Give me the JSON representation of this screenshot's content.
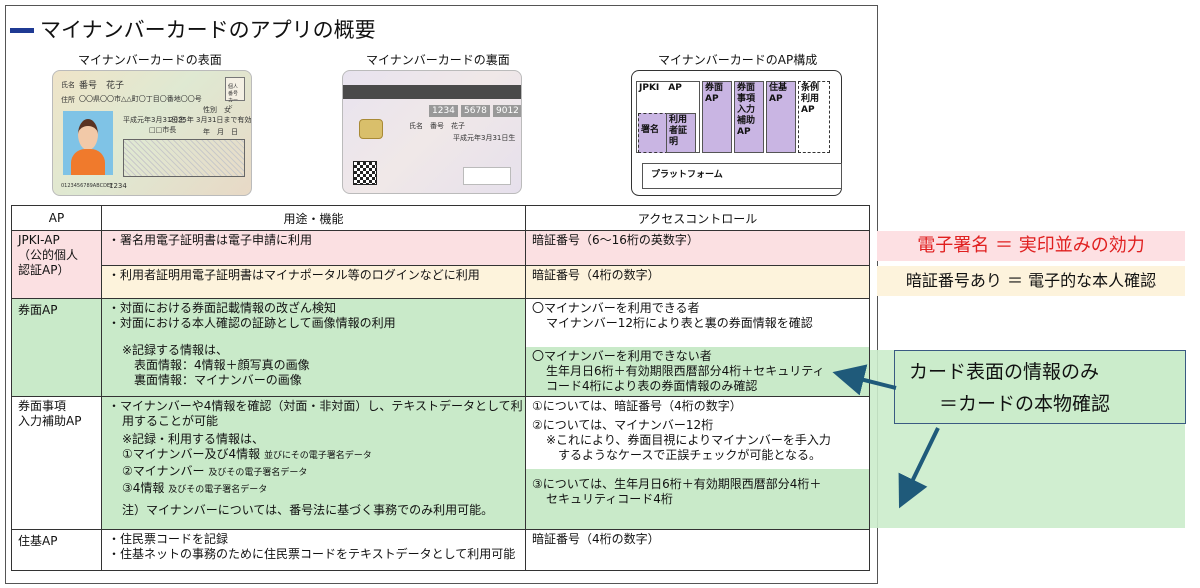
{
  "slide": {
    "title": "マイナンバーカードのアプリの概要",
    "caption_front": "マイナンバーカードの表面",
    "caption_back": "マイナンバーカードの裏面",
    "caption_ap": "マイナンバーカードのAP構成"
  },
  "card_front": {
    "name_label": "氏名",
    "name": "番号　花子",
    "address_label": "住所",
    "address": "〇〇県〇〇市△△町〇丁目〇番地〇〇号",
    "sex": "性別　女",
    "birth": "平成元年3月31日生",
    "expiry": "2025年 3月31日まで有効",
    "city": "□□市長",
    "expiry_box": "年　月　日",
    "seal": "個人番号カード",
    "serial": "0123456789ABCDEF",
    "serial2": "1234"
  },
  "card_back": {
    "number_parts": [
      "1234",
      "5678",
      "9012"
    ],
    "name": "氏名　番号　花子",
    "birth": "平成元年3月31日生"
  },
  "ap_structure": {
    "jpki": "JPKI　AP",
    "signature": "署名",
    "user_cert": "利用者証明",
    "kenmen": "券面AP",
    "kenmen_input": "券面事項入力補助AP",
    "jyuki": "住基AP",
    "jorei": "条例利用AP",
    "platform": "プラットフォーム"
  },
  "table": {
    "headers": [
      "AP",
      "用途・機能",
      "アクセスコントロール"
    ],
    "jpki": {
      "name": [
        "JPKI-AP",
        "（公的個人",
        "認証AP）"
      ],
      "use1": "・署名用電子証明書は電子申請に利用",
      "access1": "暗証番号（6～16桁の英数字）",
      "use2": "・利用者証明用電子証明書はマイナポータル等のログインなどに利用",
      "access2": "暗証番号（4桁の数字）"
    },
    "kenmen": {
      "name": "券面AP",
      "use": [
        "・対面における券面記載情報の改ざん検知",
        "・対面における本人確認の証跡として画像情報の利用"
      ],
      "record_head": "※記録する情報は、",
      "record": [
        "表面情報：4情報＋顔写真の画像",
        "裏面情報：マイナンバーの画像"
      ],
      "access_a_head": "〇マイナンバーを利用できる者",
      "access_a": "マイナンバー12桁により表と裏の券面情報を確認",
      "access_b_head": "〇マイナンバーを利用できない者",
      "access_b": [
        "生年月日6桁＋有効期限西暦部分4桁＋セキュリティ",
        "コード4桁により表の券面情報のみ確認"
      ]
    },
    "kenmen_input": {
      "name": [
        "券面事項",
        "入力補助AP"
      ],
      "use": [
        "・マイナンバーや4情報を確認（対面・非対面）し、テキストデータとして利",
        "用することが可能"
      ],
      "record_head": "※記録・利用する情報は、",
      "items": [
        {
          "main": "①マイナンバー及び4情報",
          "sub": "並びにその電子署名データ"
        },
        {
          "main": "②マイナンバー",
          "sub": "及びその電子署名データ"
        },
        {
          "main": "③4情報",
          "sub": "及びその電子署名データ"
        }
      ],
      "note": "注）マイナンバーについては、番号法に基づく事務でのみ利用可能。",
      "access1": "①については、暗証番号（4桁の数字）",
      "access2_head": "②については、マイナンバー12桁",
      "access2": [
        "※これにより、券面目視によりマイナンバーを手入力",
        "するようなケースで正誤チェックが可能となる。"
      ],
      "access3": [
        "③については、生年月日6桁＋有効期限西暦部分4桁＋",
        "セキュリティコード4桁"
      ]
    },
    "jyuki": {
      "name": "住基AP",
      "use": [
        "・住民票コードを記録",
        "・住基ネットの事務のために住民票コードをテキストデータとして利用可能"
      ],
      "access": "暗証番号（4桁の数字）"
    }
  },
  "annotations": {
    "signature_effect": "電子署名 ＝ 実印並みの効力",
    "pin_identity": "暗証番号あり ＝ 電子的な本人確認",
    "callout_line1": "カード表面の情報のみ",
    "callout_line2": "＝カードの本物確認"
  },
  "colors": {
    "pink": "#fbe0e2",
    "cream": "#fdf3dc",
    "green": "#c9eac9",
    "arrow": "#1f5a7a",
    "title_bar": "#1f3a93",
    "red_text": "#e02020"
  }
}
